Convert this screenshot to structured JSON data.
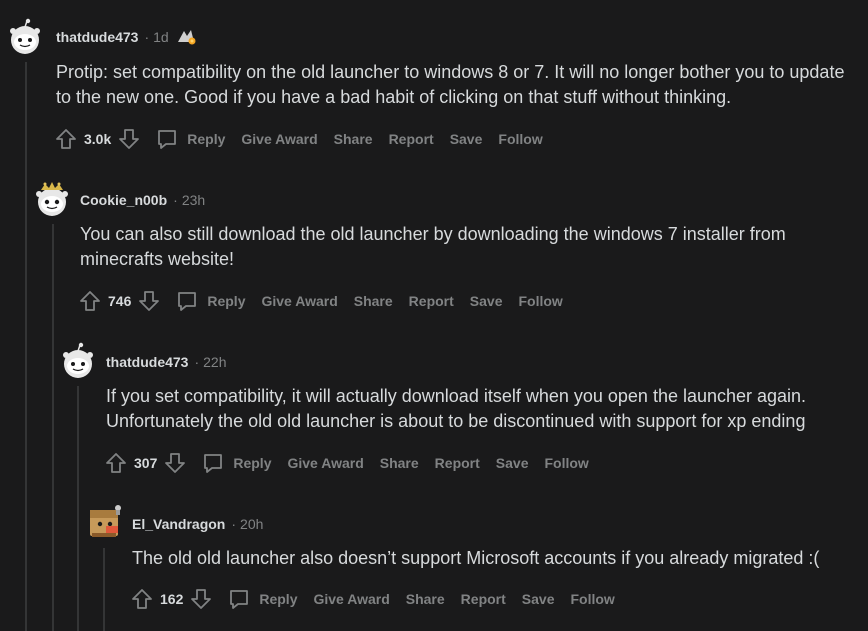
{
  "comments": [
    {
      "username": "thatdude473",
      "time": "1d",
      "text": "Protip: set compatibility on the old launcher to windows 8 or 7. It will no longer bother you to update to the new one. Good if you have a bad habit of clicking on that stuff without thinking.",
      "score": "3.0k"
    },
    {
      "username": "Cookie_n00b",
      "time": "23h",
      "text": "You can also still download the old launcher by downloading the windows 7 installer from minecrafts website!",
      "score": "746"
    },
    {
      "username": "thatdude473",
      "time": "22h",
      "text": "If you set compatibility, it will actually download itself when you open the launcher again. Unfortunately the old old launcher is about to be discontinued with support for xp ending",
      "score": "307"
    },
    {
      "username": "El_Vandragon",
      "time": "20h",
      "text": "The old old launcher also doesn’t support Microsoft accounts if you already migrated :(",
      "score": "162"
    }
  ],
  "actions": {
    "reply": "Reply",
    "give_award": "Give Award",
    "share": "Share",
    "report": "Report",
    "save": "Save",
    "follow": "Follow"
  },
  "separator": "·",
  "colors": {
    "background": "#1a1a1b",
    "text": "#d7dadc",
    "muted": "#818384",
    "thread_line": "#343536"
  }
}
